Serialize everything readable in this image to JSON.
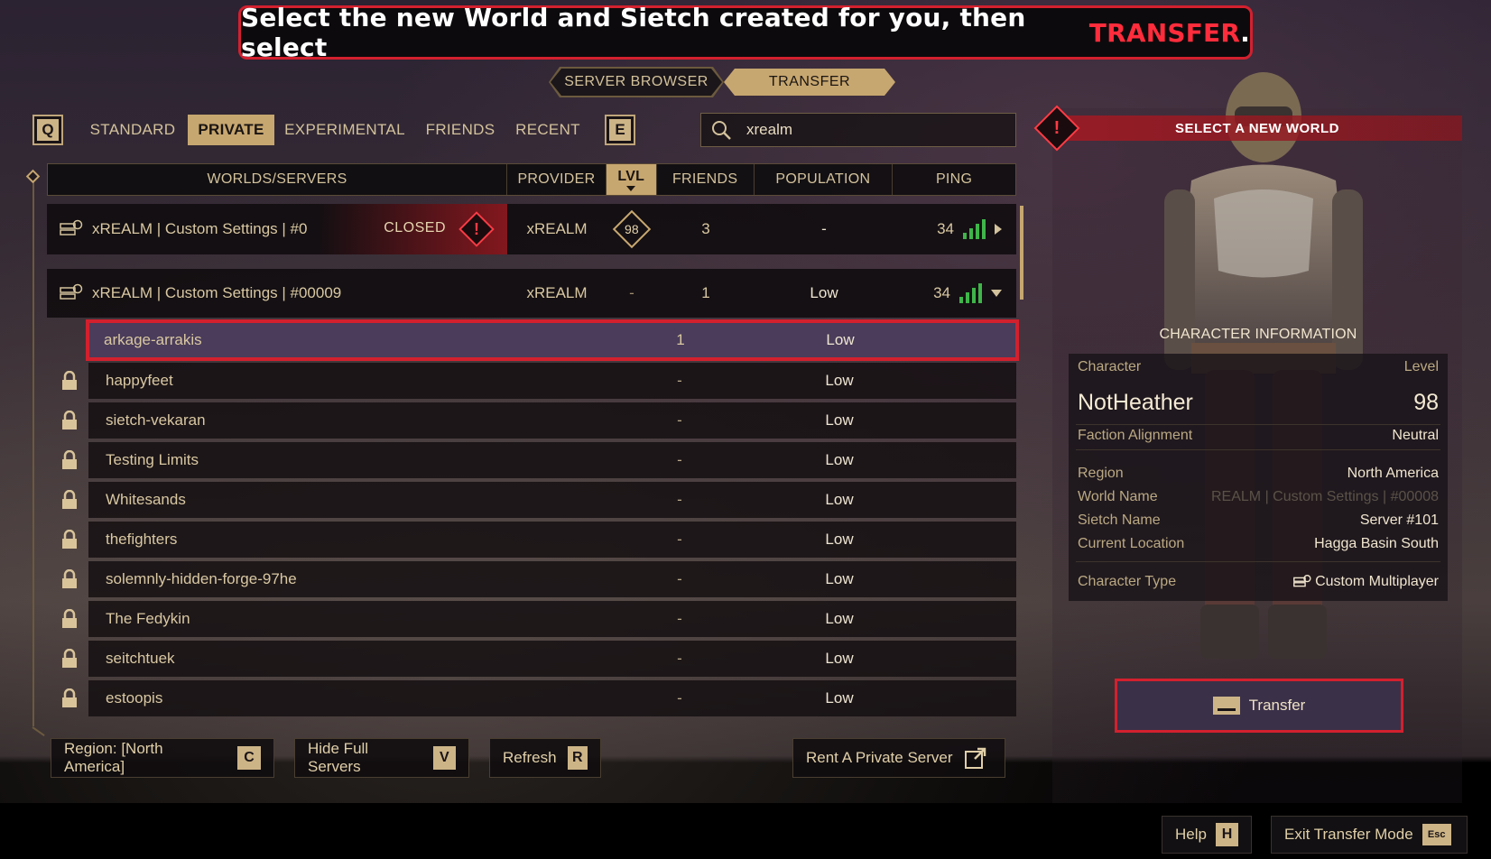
{
  "banner": {
    "prefix": "Select the new World and Sietch created for you, then select",
    "highlight": "TRANSFER",
    "suffix": "."
  },
  "subtabs": {
    "server_browser": "SERVER BROWSER",
    "transfer": "TRANSFER"
  },
  "filters": {
    "left_key": "Q",
    "right_key": "E",
    "tabs": [
      "STANDARD",
      "PRIVATE",
      "EXPERIMENTAL",
      "FRIENDS",
      "RECENT"
    ],
    "active": "PRIVATE"
  },
  "search": {
    "value": "xrealm",
    "icon": "search-icon"
  },
  "table": {
    "headers": [
      "WORLDS/SERVERS",
      "PROVIDER",
      "LVL",
      "FRIENDS",
      "POPULATION",
      "PING"
    ],
    "sort_column": "LVL",
    "servers": [
      {
        "name": "xREALM | Custom Settings | #0",
        "status": "CLOSED",
        "provider": "xREALM",
        "lvl": "98",
        "friends": "3",
        "population": "-",
        "ping": "34"
      },
      {
        "name": "xREALM | Custom Settings | #00009",
        "status": "",
        "provider": "xREALM",
        "lvl": "-",
        "friends": "1",
        "population": "Low",
        "ping": "34"
      }
    ],
    "sietches": [
      {
        "name": "arkage-arrakis",
        "friends": "1",
        "population": "Low",
        "locked": false,
        "selected": true
      },
      {
        "name": "happyfeet",
        "friends": "-",
        "population": "Low",
        "locked": true
      },
      {
        "name": "sietch-vekaran",
        "friends": "-",
        "population": "Low",
        "locked": true
      },
      {
        "name": "Testing Limits",
        "friends": "-",
        "population": "Low",
        "locked": true
      },
      {
        "name": "Whitesands",
        "friends": "-",
        "population": "Low",
        "locked": true
      },
      {
        "name": "thefighters",
        "friends": "-",
        "population": "Low",
        "locked": true
      },
      {
        "name": "solemnly-hidden-forge-97he",
        "friends": "-",
        "population": "Low",
        "locked": true
      },
      {
        "name": "The Fedykin",
        "friends": "-",
        "population": "Low",
        "locked": true
      },
      {
        "name": "seitchtuek",
        "friends": "-",
        "population": "Low",
        "locked": true
      },
      {
        "name": "estoopis",
        "friends": "-",
        "population": "Low",
        "locked": true
      }
    ]
  },
  "bottom_buttons": {
    "region": {
      "label": "Region: [North America]",
      "key": "C"
    },
    "hide_full": {
      "label": "Hide Full Servers",
      "key": "V"
    },
    "refresh": {
      "label": "Refresh",
      "key": "R"
    },
    "rent": {
      "label": "Rent A Private Server"
    }
  },
  "right_panel": {
    "select_world": "SELECT A NEW WORLD",
    "char_info_title": "CHARACTER INFORMATION",
    "character_label": "Character",
    "level_label": "Level",
    "character_name": "NotHeather",
    "level": "98",
    "faction_label": "Faction Alignment",
    "faction": "Neutral",
    "region_label": "Region",
    "region": "North America",
    "world_label": "World Name",
    "world": "REALM | Custom Settings | #00008",
    "sietch_label": "Sietch Name",
    "sietch": "Server #101",
    "location_label": "Current Location",
    "location": "Hagga Basin South",
    "type_label": "Character Type",
    "type": "Custom Multiplayer",
    "transfer_label": "Transfer"
  },
  "footer": {
    "help": {
      "label": "Help",
      "key": "H"
    },
    "exit": {
      "label": "Exit Transfer Mode",
      "key": "Esc"
    }
  },
  "colors": {
    "accent_gold": "#c7a770",
    "alert_red": "#d3202e",
    "ping_green": "#3fb54a"
  }
}
